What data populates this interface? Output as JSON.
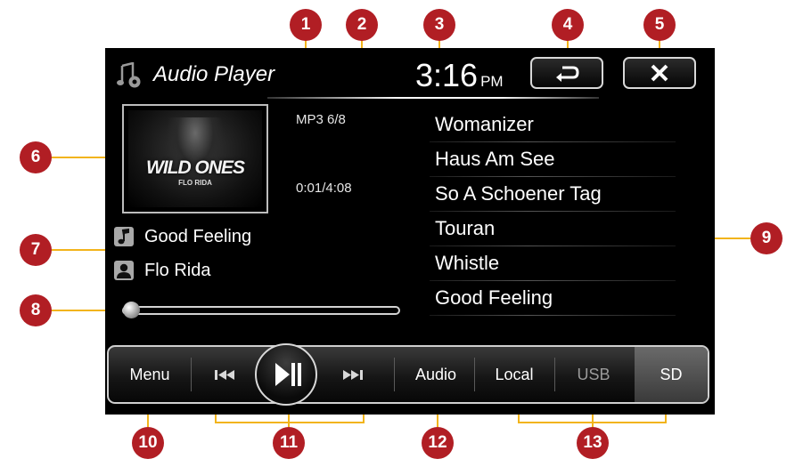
{
  "app": {
    "title": "Audio Player",
    "icon": "music-settings-icon"
  },
  "clock": {
    "time": "3:16",
    "ampm": "PM"
  },
  "buttons": {
    "back_icon": "back-arrow-icon",
    "close_icon": "close-x-icon"
  },
  "track": {
    "format": "MP3 6/8",
    "time": "0:01/4:08",
    "song": "Good Feeling",
    "artist": "Flo Rida",
    "album_logo": "WILD ONES",
    "album_sub": "FLO RIDA",
    "progress": 0.004
  },
  "playlist": [
    "Womanizer",
    "Haus Am See",
    "So A Schoener Tag",
    "Touran",
    "Whistle",
    "Good Feeling"
  ],
  "bottom_bar": {
    "menu": "Menu",
    "prev_icon": "skip-previous-icon",
    "play_icon": "play-pause-icon",
    "next_icon": "skip-next-icon",
    "audio": "Audio",
    "local": "Local",
    "usb": "USB",
    "sd": "SD"
  },
  "callouts": [
    "1",
    "2",
    "3",
    "4",
    "5",
    "6",
    "7",
    "8",
    "9",
    "10",
    "11",
    "12",
    "13"
  ],
  "colors": {
    "badge": "#b11e24",
    "line": "#f2b41b",
    "screen": "#000000"
  }
}
